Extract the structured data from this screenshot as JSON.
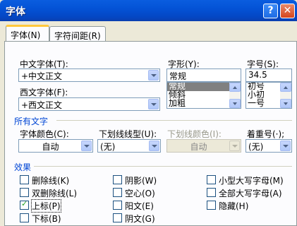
{
  "window": {
    "title": "字体",
    "help_glyph": "?",
    "close_glyph": "✕"
  },
  "tabs": [
    {
      "label": "字体(N)",
      "active": true
    },
    {
      "label": "字符间距(R)",
      "active": false
    }
  ],
  "font": {
    "chinese_label": "中文字体(T):",
    "chinese_value": "+中文正文",
    "western_label": "西文字体(F):",
    "western_value": "+西文正文",
    "style_label": "字形(Y):",
    "style_value": "常规",
    "style_options": [
      "常规",
      "倾斜",
      "加粗"
    ],
    "size_label": "字号(S):",
    "size_value": "34.5",
    "size_options": [
      "初号",
      "小初",
      "一号"
    ]
  },
  "all_text": {
    "section_title": "所有文字",
    "color_label": "字体颜色(C):",
    "color_value": "自动",
    "underline_label": "下划线线型(U):",
    "underline_value": "(无)",
    "underline_color_label": "下划线颜色(I):",
    "underline_color_value": "自动",
    "emphasis_label": "着重号(·);",
    "emphasis_value": "(无)"
  },
  "effects": {
    "section_title": "效果",
    "items": [
      {
        "label": "删除线(K)",
        "checked": false
      },
      {
        "label": "阴影(W)",
        "checked": false
      },
      {
        "label": "小型大写字母(M)",
        "checked": false
      },
      {
        "label": "双删除线(L)",
        "checked": false
      },
      {
        "label": "空心(O)",
        "checked": false
      },
      {
        "label": "全部大写字母(A)",
        "checked": false
      },
      {
        "label": "上标(P)",
        "checked": true
      },
      {
        "label": "阳文(E)",
        "checked": false
      },
      {
        "label": "隐藏(H)",
        "checked": false
      },
      {
        "label": "下标(B)",
        "checked": false
      },
      {
        "label": "阴文(G)",
        "checked": false
      }
    ]
  }
}
